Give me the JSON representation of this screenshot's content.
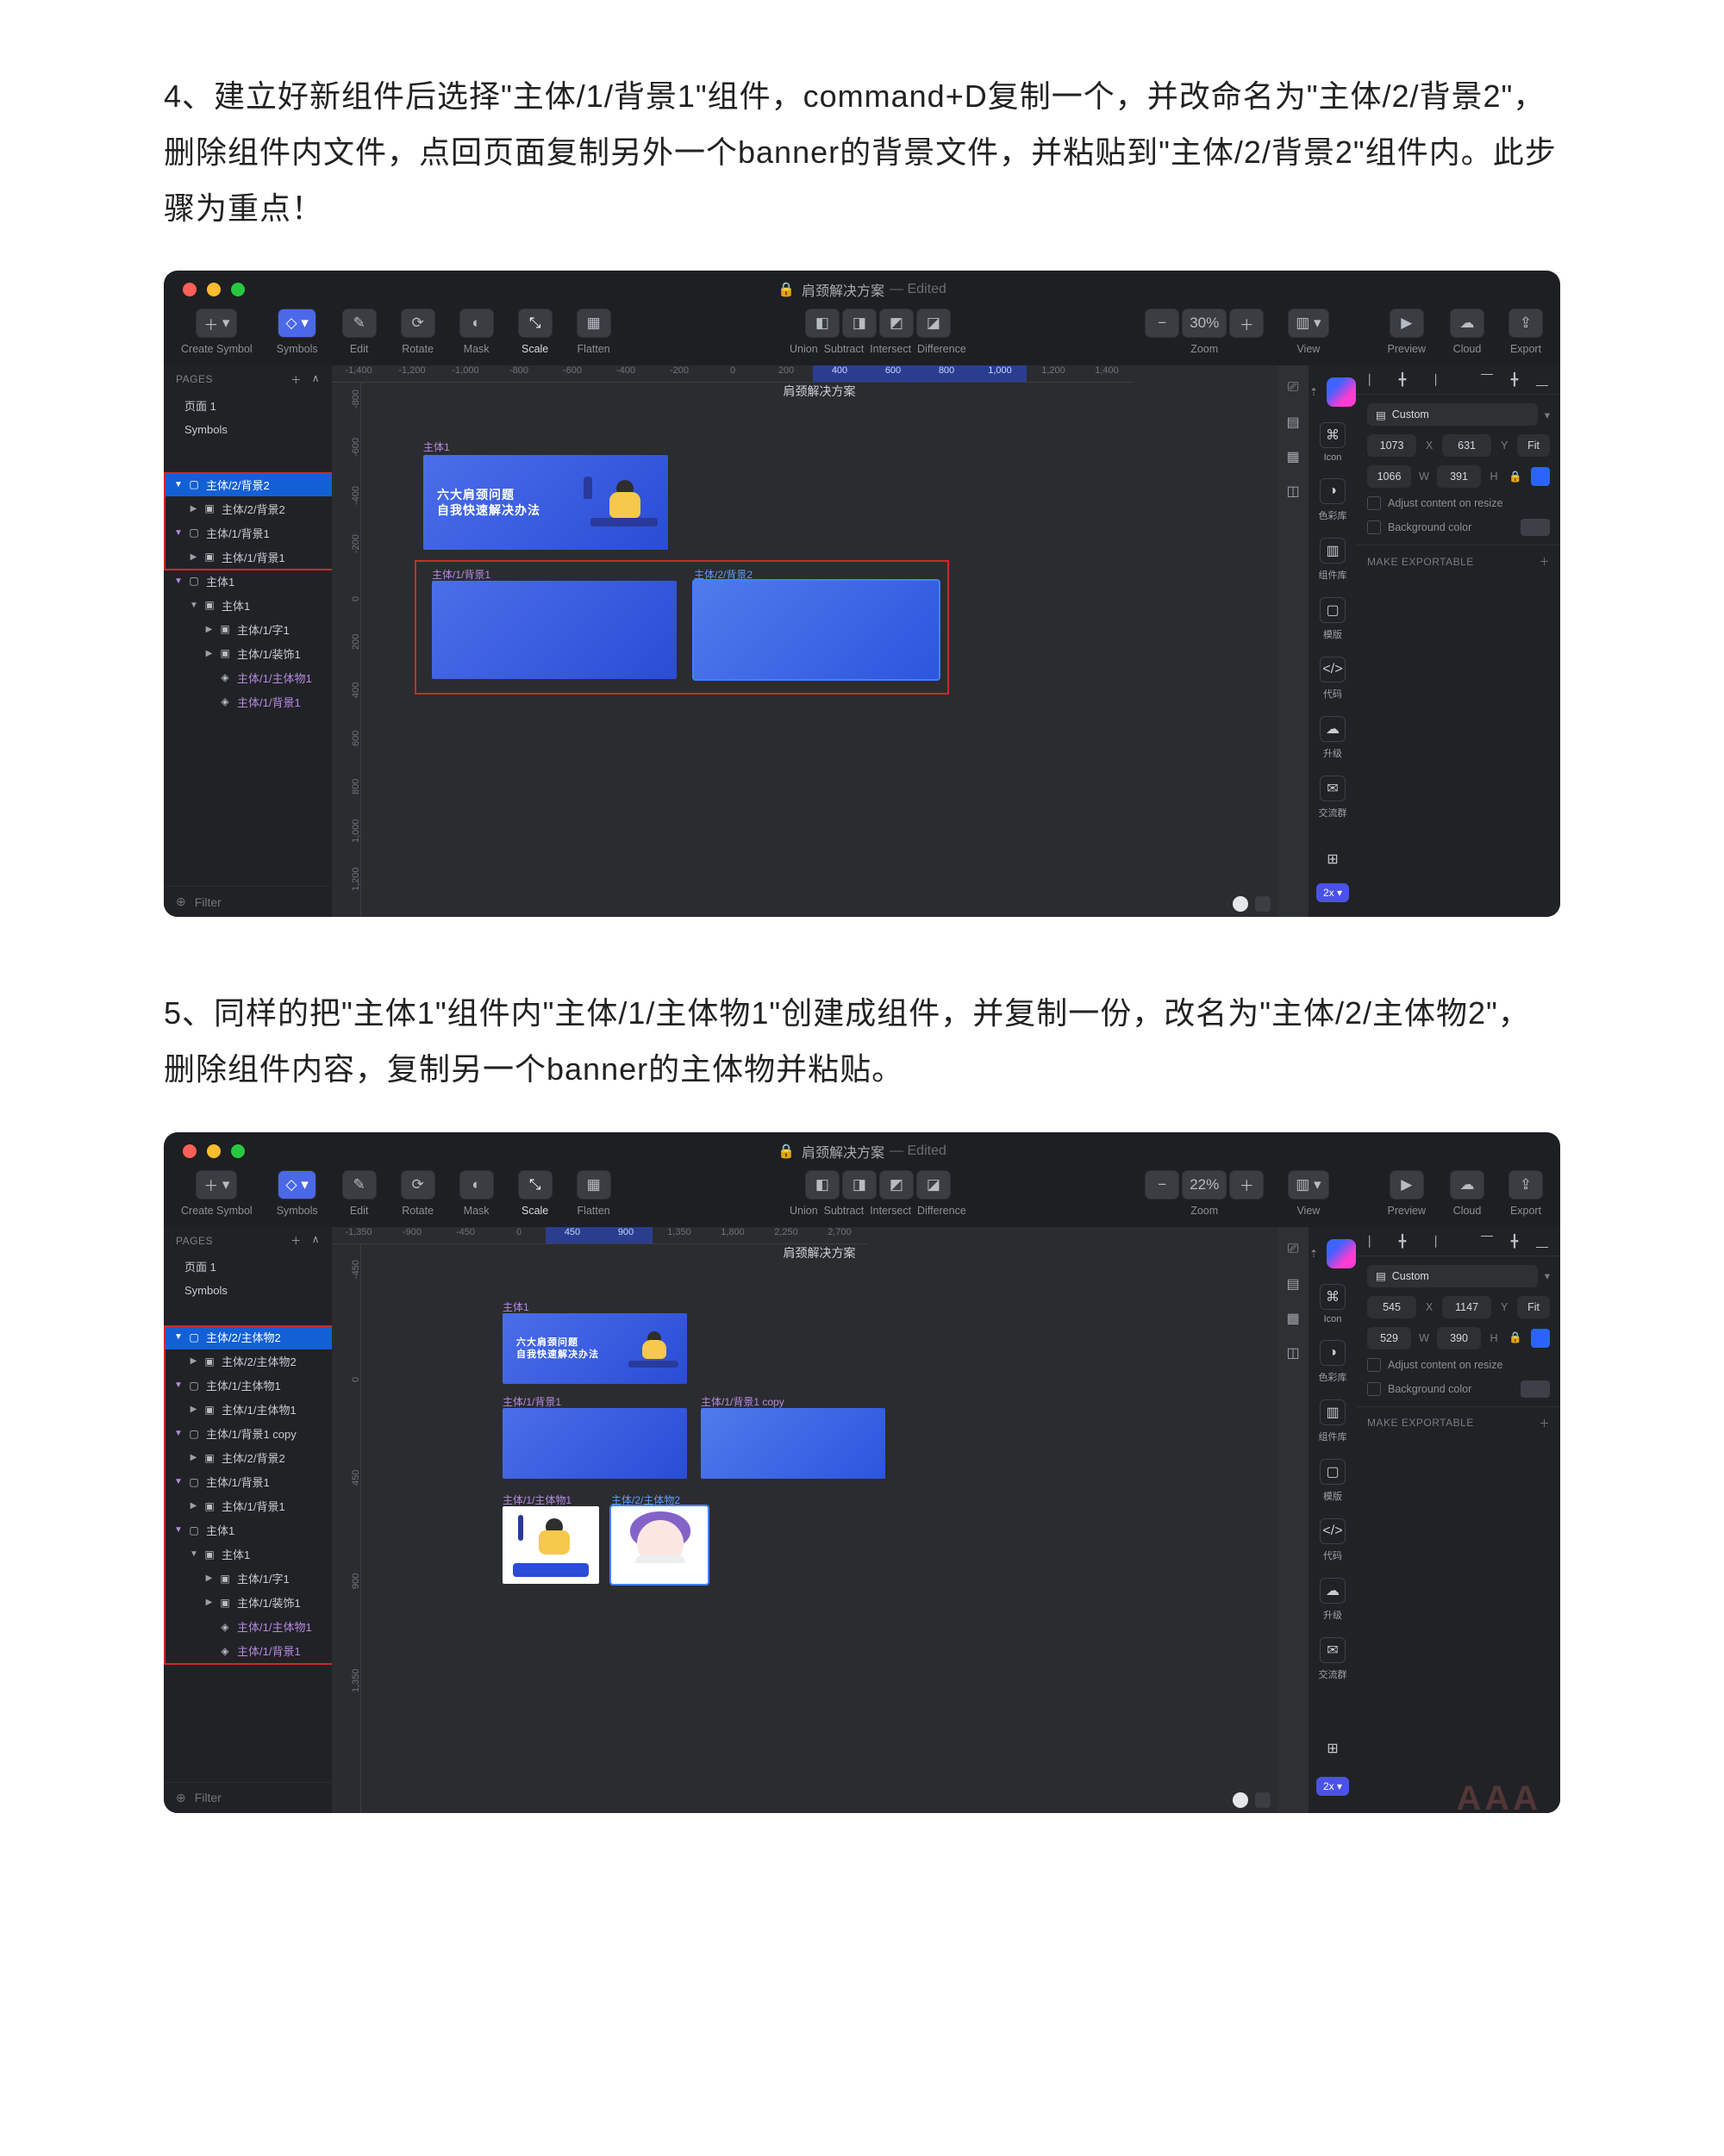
{
  "doc": {
    "step4": "4、建立好新组件后选择\"主体/1/背景1\"组件，command+D复制一个，并改命名为\"主体/2/背景2\"，删除组件内文件，点回页面复制另外一个banner的背景文件，并粘贴到\"主体/2/背景2\"组件内。此步骤为重点！",
    "step5": "5、同样的把\"主体1\"组件内\"主体/1/主体物1\"创建成组件，并复制一份，改名为\"主体/2/主体物2\"，删除组件内容，复制另一个banner的主体物并粘贴。"
  },
  "window": {
    "file": "肩颈解决方案",
    "edited": "— Edited",
    "doc_center": "肩颈解决方案"
  },
  "toolbar": {
    "create_symbol": "Create Symbol",
    "symbols": "Symbols",
    "edit": "Edit",
    "rotate": "Rotate",
    "mask": "Mask",
    "scale": "Scale",
    "flatten": "Flatten",
    "union": "Union",
    "subtract": "Subtract",
    "intersect": "Intersect",
    "difference": "Difference",
    "zoom": "Zoom",
    "view": "View",
    "preview": "Preview",
    "cloud": "Cloud",
    "export": "Export",
    "insert": "＋"
  },
  "zoom": {
    "a": "30%",
    "b": "22%"
  },
  "pages": {
    "hdr": "PAGES",
    "p1": "页面 1",
    "symbols": "Symbols",
    "filter": "Filter"
  },
  "layers_a": {
    "0": "主体/2/背景2",
    "1": "主体/2/背景2",
    "2": "主体/1/背景1",
    "3": "主体/1/背景1",
    "4": "主体1",
    "5": "主体1",
    "6": "主体/1/字1",
    "7": "主体/1/装饰1",
    "8": "主体/1/主体物1",
    "9": "主体/1/背景1"
  },
  "layers_b": {
    "0": "主体/2/主体物2",
    "1": "主体/2/主体物2",
    "2": "主体/1/主体物1",
    "3": "主体/1/主体物1",
    "4": "主体/1/背景1 copy",
    "5": "主体/2/背景2",
    "6": "主体/1/背景1",
    "7": "主体/1/背景1",
    "8": "主体1",
    "9": "主体1",
    "10": "主体/1/字1",
    "11": "主体/1/装饰1",
    "12": "主体/1/主体物1",
    "13": "主体/1/背景1"
  },
  "ruler_a": [
    "-1,400",
    "-1,200",
    "-1,000",
    "-800",
    "-600",
    "-400",
    "-200",
    "0",
    "200",
    "400",
    "600",
    "800",
    "1,000",
    "1,200",
    "1,400"
  ],
  "ruler_va": [
    "-800",
    "-600",
    "-400",
    "-200",
    "0",
    "200",
    "400",
    "600",
    "800",
    "1,000",
    "1,200"
  ],
  "ruler_b": [
    "-1,350",
    "-900",
    "-450",
    "0",
    "450",
    "900",
    "1,350",
    "1,800",
    "2,250",
    "2,700"
  ],
  "ruler_vb": [
    "-450",
    "0",
    "450",
    "900",
    "1,350"
  ],
  "canvas_a": {
    "art1_label": "主体1",
    "bg1_label": "主体/1/背景1",
    "bg2_label": "主体/2/背景2",
    "banner_line1": "六大肩颈问题",
    "banner_line2": "自我快速解决办法"
  },
  "canvas_b": {
    "art1_label": "主体1",
    "bg1_label": "主体/1/背景1",
    "bg1c_label": "主体/1/背景1 copy",
    "chara1_label": "主体/1/主体物1",
    "chara2_label": "主体/2/主体物2"
  },
  "plugin": {
    "icon": "Icon",
    "color": "色彩库",
    "comp": "组件库",
    "tpl": "模版",
    "code": "代码",
    "upgrade": "升级",
    "chat": "交流群",
    "badge": "2x ▾"
  },
  "inspector": {
    "custom": "Custom",
    "a_x": "1073",
    "a_y": "631",
    "a_w": "1066",
    "a_h": "391",
    "b_x": "545",
    "b_y": "1147",
    "b_w": "529",
    "b_h": "390",
    "xL": "X",
    "yL": "Y",
    "wL": "W",
    "hL": "H",
    "fit": "Fit",
    "adjust": "Adjust content on resize",
    "bg": "Background color",
    "export": "MAKE EXPORTABLE"
  },
  "watermark": "AAA"
}
